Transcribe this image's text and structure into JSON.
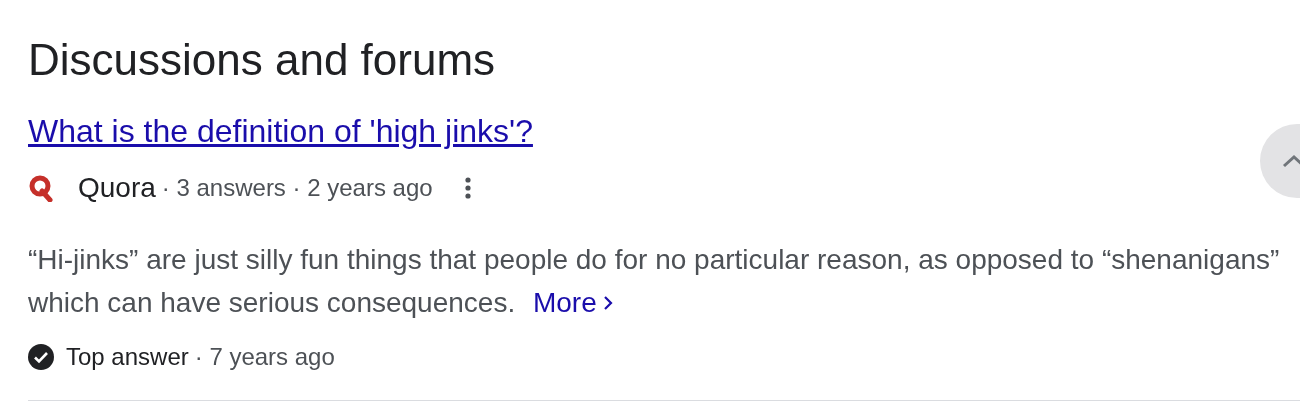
{
  "heading": "Discussions and forums",
  "result": {
    "title": "What is the definition of 'high jinks'?",
    "source": "Quora",
    "meta": "· 3 answers · 2 years ago",
    "snippet": "“Hi-jinks” are just silly fun things that people do for no particular reason, as opposed to “shenanigans” which can have serious consequences.",
    "more": "More",
    "badge": {
      "label": "Top answer",
      "meta": "· 7 years ago"
    }
  }
}
